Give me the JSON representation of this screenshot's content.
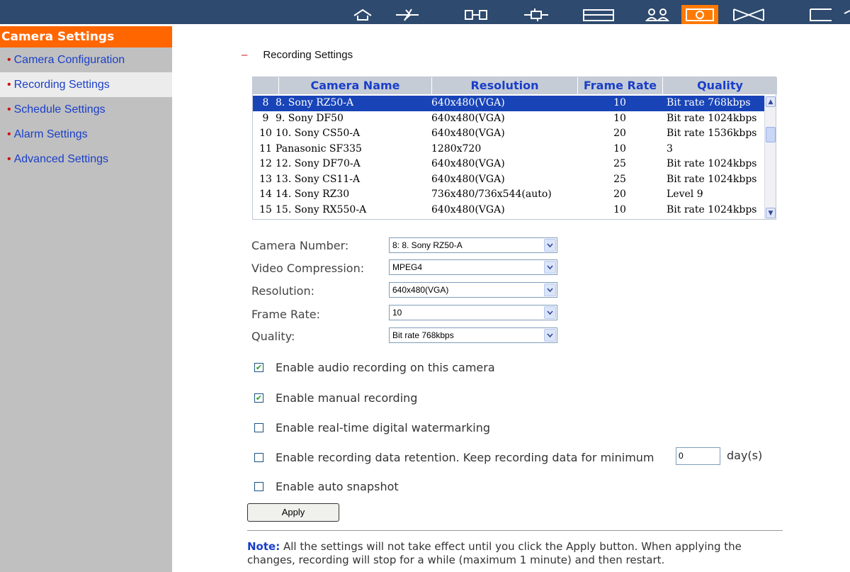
{
  "topbar": {
    "icons": [
      "home-icon",
      "lightning-icon",
      "network-icon",
      "connect-icon",
      "drive-icon",
      "users-icon",
      "camera-icon",
      "mail-icon",
      "logout-icon"
    ],
    "active": "camera-icon",
    "colors": {
      "bar": "#2e4a6e",
      "active": "#ff7a00"
    }
  },
  "sidebar": {
    "title": "Camera Settings",
    "items": [
      {
        "label": "Camera Configuration",
        "active": false
      },
      {
        "label": "Recording Settings",
        "active": true
      },
      {
        "label": "Schedule Settings",
        "active": false
      },
      {
        "label": "Alarm Settings",
        "active": false
      },
      {
        "label": "Advanced Settings",
        "active": false
      }
    ]
  },
  "main": {
    "section_title": "Recording Settings",
    "table": {
      "columns": [
        "Camera Name",
        "Resolution",
        "Frame Rate",
        "Quality"
      ],
      "rows": [
        {
          "num": "8",
          "name": "8. Sony RZ50-A",
          "resolution": "640x480(VGA)",
          "frame_rate": "10",
          "quality": "Bit rate 768kbps",
          "selected": true
        },
        {
          "num": "9",
          "name": "9. Sony DF50",
          "resolution": "640x480(VGA)",
          "frame_rate": "10",
          "quality": "Bit rate 1024kbps",
          "selected": false
        },
        {
          "num": "10",
          "name": "10. Sony CS50-A",
          "resolution": "640x480(VGA)",
          "frame_rate": "20",
          "quality": "Bit rate 1536kbps",
          "selected": false
        },
        {
          "num": "11",
          "name": "Panasonic SF335",
          "resolution": "1280x720",
          "frame_rate": "10",
          "quality": "3",
          "selected": false
        },
        {
          "num": "12",
          "name": "12. Sony DF70-A",
          "resolution": "640x480(VGA)",
          "frame_rate": "25",
          "quality": "Bit rate 1024kbps",
          "selected": false
        },
        {
          "num": "13",
          "name": "13. Sony CS11-A",
          "resolution": "640x480(VGA)",
          "frame_rate": "25",
          "quality": "Bit rate 1024kbps",
          "selected": false
        },
        {
          "num": "14",
          "name": "14. Sony RZ30",
          "resolution": "736x480/736x544(auto)",
          "frame_rate": "20",
          "quality": "Level 9",
          "selected": false
        },
        {
          "num": "15",
          "name": "15. Sony RX550-A",
          "resolution": "640x480(VGA)",
          "frame_rate": "10",
          "quality": "Bit rate 1024kbps",
          "selected": false
        }
      ]
    },
    "form": {
      "camera_number": {
        "label": "Camera Number:",
        "value": "8: 8. Sony RZ50-A"
      },
      "video_compression": {
        "label": "Video Compression:",
        "value": "MPEG4"
      },
      "resolution": {
        "label": "Resolution:",
        "value": "640x480(VGA)"
      },
      "frame_rate": {
        "label": "Frame Rate:",
        "value": "10"
      },
      "quality": {
        "label": "Quality:",
        "value": "Bit rate 768kbps"
      }
    },
    "checkboxes": {
      "audio": {
        "label": "Enable audio recording on this camera",
        "checked": true
      },
      "manual": {
        "label": "Enable manual recording",
        "checked": true
      },
      "watermark": {
        "label": "Enable real-time digital watermarking",
        "checked": false
      },
      "retention": {
        "label": "Enable recording data retention. Keep recording data for minimum",
        "checked": false,
        "value": "0",
        "unit": "day(s)"
      },
      "snapshot": {
        "label": "Enable auto snapshot",
        "checked": false
      }
    },
    "apply_label": "Apply",
    "note_label": "Note:",
    "note_text": " All the settings will not take effect until you click the Apply button. When applying the changes, recording will stop for a while (maximum 1 minute) and then restart."
  }
}
